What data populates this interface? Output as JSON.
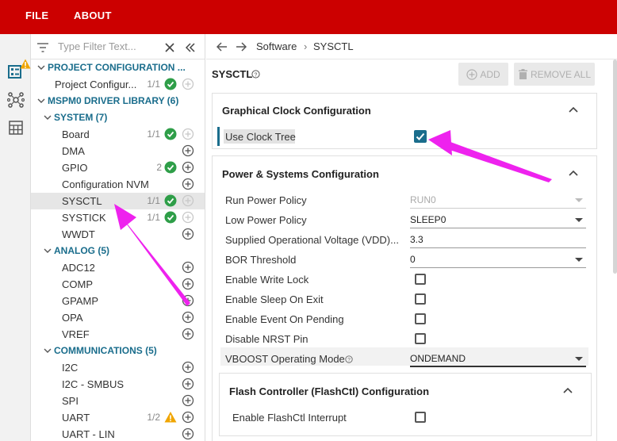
{
  "menu": {
    "file": "FILE",
    "about": "ABOUT"
  },
  "filter": {
    "placeholder": "Type Filter Text..."
  },
  "tree": {
    "project_config": "PROJECT CONFIGURATION ...",
    "project_config_item": "Project Configur...",
    "project_config_count": "1/1",
    "driver_lib": "MSPM0 DRIVER LIBRARY (6)",
    "system": "SYSTEM (7)",
    "system_items": [
      {
        "label": "Board",
        "count": "1/1",
        "status": "check"
      },
      {
        "label": "DMA",
        "count": "",
        "status": "none"
      },
      {
        "label": "GPIO",
        "count": "2",
        "status": "check"
      },
      {
        "label": "Configuration NVM",
        "count": "",
        "status": "none"
      },
      {
        "label": "SYSCTL",
        "count": "1/1",
        "status": "check"
      },
      {
        "label": "SYSTICK",
        "count": "1/1",
        "status": "check"
      },
      {
        "label": "WWDT",
        "count": "",
        "status": "none"
      }
    ],
    "analog": "ANALOG (5)",
    "analog_items": [
      {
        "label": "ADC12"
      },
      {
        "label": "COMP"
      },
      {
        "label": "GPAMP"
      },
      {
        "label": "OPA"
      },
      {
        "label": "VREF"
      }
    ],
    "comms": "COMMUNICATIONS (5)",
    "comms_items": [
      {
        "label": "I2C",
        "count": "",
        "status": "none"
      },
      {
        "label": "I2C - SMBUS",
        "count": "",
        "status": "none"
      },
      {
        "label": "SPI",
        "count": "",
        "status": "none"
      },
      {
        "label": "UART",
        "count": "1/2",
        "status": "warning"
      },
      {
        "label": "UART - LIN",
        "count": "",
        "status": "none"
      }
    ]
  },
  "breadcrumb": {
    "software": "Software",
    "separator": "›",
    "sysctl": "SYSCTL"
  },
  "header": {
    "title": "SYSCTL",
    "add": "ADD",
    "remove_all": "REMOVE ALL"
  },
  "clock_panel": {
    "title": "Graphical Clock Configuration",
    "use_clock_tree": "Use Clock Tree",
    "use_clock_tree_checked": true
  },
  "power_panel": {
    "title": "Power & Systems Configuration",
    "run_power_policy": {
      "label": "Run Power Policy",
      "value": "RUN0"
    },
    "low_power_policy": {
      "label": "Low Power Policy",
      "value": "SLEEP0"
    },
    "supplied_voltage": {
      "label": "Supplied Operational Voltage (VDD)...",
      "value": "3.3"
    },
    "bor_threshold": {
      "label": "BOR Threshold",
      "value": "0"
    },
    "enable_write_lock": "Enable Write Lock",
    "enable_sleep_on_exit": "Enable Sleep On Exit",
    "enable_event_on_pending": "Enable Event On Pending",
    "disable_nrst_pin": "Disable NRST Pin",
    "vboost_mode": {
      "label": "VBOOST Operating Mode",
      "value": "ONDEMAND"
    }
  },
  "flash_panel": {
    "title": "Flash Controller (FlashCtl) Configuration",
    "enable_interrupt": "Enable FlashCtl Interrupt"
  },
  "colors": {
    "menubar": "#cc0000",
    "category": "#1a6d8c",
    "check_green": "#2e9e48",
    "warning": "#f0a500",
    "checkbox_teal": "#1a6d8c",
    "annotation_arrow": "#ee22ee"
  }
}
